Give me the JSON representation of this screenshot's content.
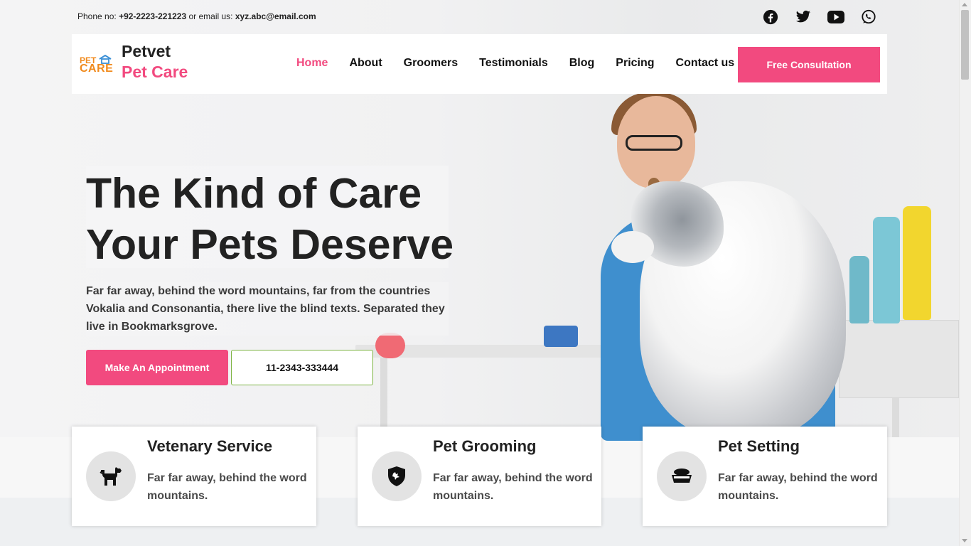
{
  "topbar": {
    "phone_label": "Phone no: ",
    "phone": "+92-2223-221223",
    "email_label": " or email us: ",
    "email": "xyz.abc@email.com"
  },
  "socials": [
    "facebook-icon",
    "twitter-icon",
    "youtube-icon",
    "whatsapp-icon"
  ],
  "header": {
    "logo_top": "PET",
    "logo_bottom": "CARE",
    "brand_line1": "Petvet",
    "brand_line2": "Pet Care",
    "nav": [
      "Home",
      "About",
      "Groomers",
      "Testimonials",
      "Blog",
      "Pricing",
      "Contact us"
    ],
    "active": "Home",
    "cta": "Free Consultation"
  },
  "hero": {
    "headline_line1": "The Kind of Care",
    "headline_line2": "Your Pets Deserve",
    "subtext": "Far far away, behind the word mountains, far from the countries Vokalia and Consonantia, there live the blind texts. Separated they live in Bookmarksgrove.",
    "btn_appointment": "Make An Appointment",
    "btn_phone": "11-2343-333444"
  },
  "services": [
    {
      "title": "Vetenary Service",
      "text": "Far far away, behind the word mountains.",
      "icon": "dog-icon"
    },
    {
      "title": "Pet Grooming",
      "text": "Far far away, behind the word mountains.",
      "icon": "shield-paw-icon"
    },
    {
      "title": "Pet Setting",
      "text": "Far far away, behind the word mountains.",
      "icon": "pet-bowl-icon"
    }
  ],
  "colors": {
    "accent": "#f24a7f",
    "logo": "#f08a1c",
    "phone_border": "#7cb342"
  }
}
